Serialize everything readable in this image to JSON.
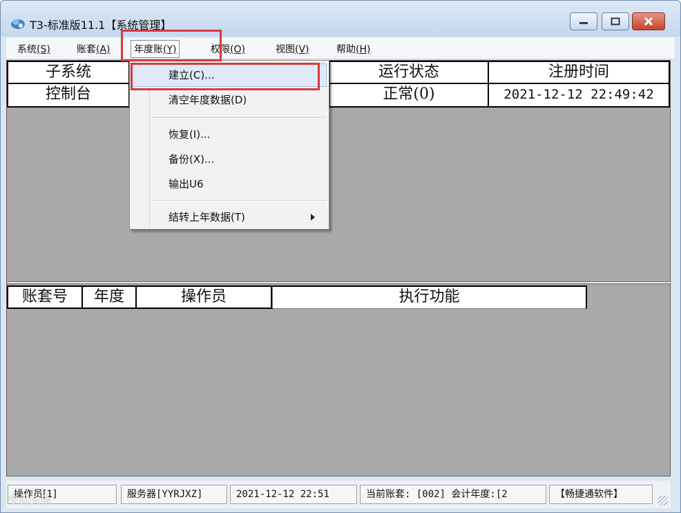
{
  "window": {
    "title": "T3-标准版11.1【系统管理】",
    "buttons": {
      "minimize": "minimize",
      "maximize": "maximize",
      "close": "close"
    }
  },
  "menubar": [
    {
      "label": "系统",
      "key": "(S)"
    },
    {
      "label": "账套",
      "key": "(A)"
    },
    {
      "label": "年度账",
      "key": "(Y)"
    },
    {
      "label": "权限",
      "key": "(O)"
    },
    {
      "label": "视图",
      "key": "(V)"
    },
    {
      "label": "帮助",
      "key": "(H)"
    }
  ],
  "dropdown": {
    "items": [
      "建立(C)...",
      "清空年度数据(D)",
      "恢复(I)...",
      "备份(X)...",
      "输出U6",
      "结转上年数据(T)"
    ],
    "highlighted_index": 0
  },
  "subsystems_table": {
    "headers": [
      "子系统",
      "",
      "运行状态",
      "注册时间"
    ],
    "rows": [
      [
        "控制台",
        "",
        "正常(0)",
        "2021-12-12 22:49:42"
      ]
    ]
  },
  "operations_table": {
    "headers": [
      "账套号",
      "年度",
      "操作员",
      "执行功能"
    ]
  },
  "statusbar": {
    "operator": "操作员[1]",
    "server": "服务器[YYRJXZ]",
    "datetime": "2021-12-12 22:51",
    "current_account": "当前账套: [002] 会计年度:[2",
    "brand": "【畅捷通软件】"
  },
  "watermark": "今日头条",
  "colors": {
    "highlight_box": "#d63a3a",
    "client_bg": "#a9a9a9",
    "menu_hover": "#dfe9f7"
  }
}
